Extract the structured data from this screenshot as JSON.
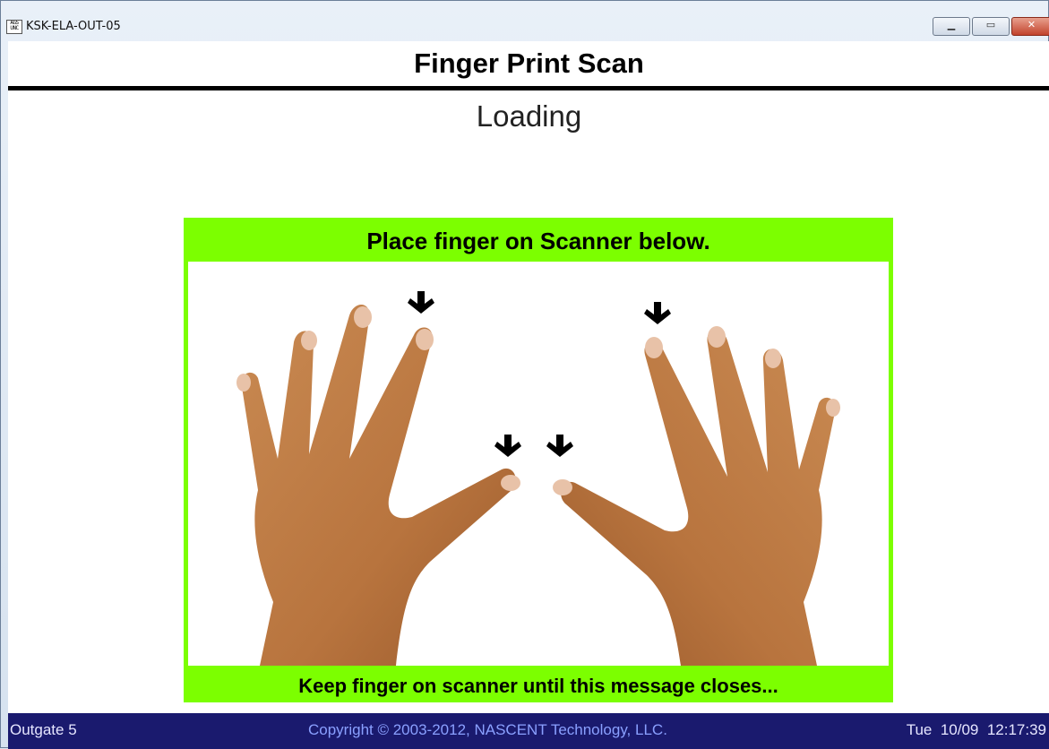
{
  "window": {
    "title": "KSK-ELA-OUT-05",
    "icon_name": "app-icon",
    "icon_text": "AGS UNC"
  },
  "header": {
    "title": "Finger Print Scan",
    "status": "Loading"
  },
  "scan_panel": {
    "instruction_top": "Place finger on Scanner below.",
    "instruction_bottom": "Keep finger on scanner until this message closes...",
    "background_color": "#7cff00",
    "image": "two-hands-fingerprint-guide"
  },
  "statusbar": {
    "location": "Outgate 5",
    "copyright": "Copyright © 2003-2012, NASCENT Technology, LLC.",
    "datetime": "Tue  10/09  12:17:39"
  }
}
